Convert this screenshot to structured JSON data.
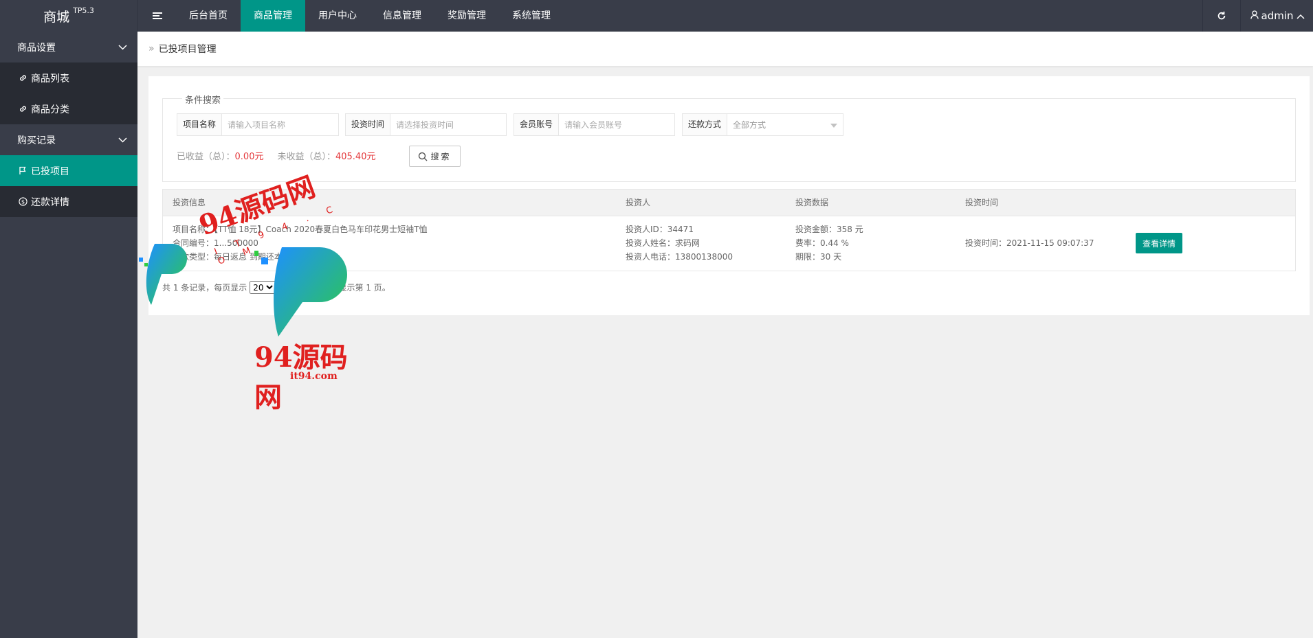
{
  "app": {
    "name": "商城",
    "version": "TP5.3"
  },
  "topnav": {
    "items": [
      {
        "label": "后台首页",
        "active": false
      },
      {
        "label": "商品管理",
        "active": true
      },
      {
        "label": "用户中心",
        "active": false
      },
      {
        "label": "信息管理",
        "active": false
      },
      {
        "label": "奖励管理",
        "active": false
      },
      {
        "label": "系统管理",
        "active": false
      }
    ],
    "user": "admin",
    "icons": {
      "toggle": "menu-icon",
      "refresh": "refresh-icon",
      "user": "user-icon",
      "caret": "chevron-up-icon"
    }
  },
  "sidebar": {
    "group1": "商品设置",
    "item1": "商品列表",
    "item2": "商品分类",
    "group2": "购买记录",
    "item3": "已投项目",
    "item4": "还款详情"
  },
  "breadcrumb": {
    "label": "已投项目管理"
  },
  "search": {
    "legend": "条件搜索",
    "project_label": "项目名称",
    "project_placeholder": "请输入项目名称",
    "time_label": "投资时间",
    "time_placeholder": "请选择投资时间",
    "member_label": "会员账号",
    "member_placeholder": "请输入会员账号",
    "repay_label": "还款方式",
    "repay_value": "全部方式",
    "button": "搜索"
  },
  "stats": {
    "earned_label": "已收益（总）：",
    "earned_value": "0.00元",
    "unearned_label": "未收益（总）：",
    "unearned_value": "405.40元"
  },
  "table": {
    "headers": [
      "投资信息",
      "投资人",
      "投资数据",
      "投资时间"
    ],
    "row": {
      "info1": "项目名称：【TT恤 18元】Coach 2020春夏白色马车印花男士短袖T恤",
      "info2": "合同编号：1...500000",
      "info3": "还款类型：每日返息 到期还本",
      "investor_id": "投资人ID：34471",
      "investor_name": "投资人姓名：求码网",
      "investor_phone": "投资人电话：13800138000",
      "amount": "投资金额：358 元",
      "rate": "费率：0.44 %",
      "term": "期限：30 天",
      "time": "投资时间：2021-11-15 09:07:37",
      "action": "查看详情"
    }
  },
  "pager": {
    "prefix": "共 1 条记录，每页显示",
    "page_size": "20",
    "suffix": "条，共 1 页当前显示第 1 页。"
  },
  "watermark": {
    "text": "94源码网",
    "url": "it94.com",
    "letters": "I T 9 4 . C O M"
  },
  "colors": {
    "accent": "#009688",
    "dark": "#393d49",
    "red": "#e4393c"
  }
}
